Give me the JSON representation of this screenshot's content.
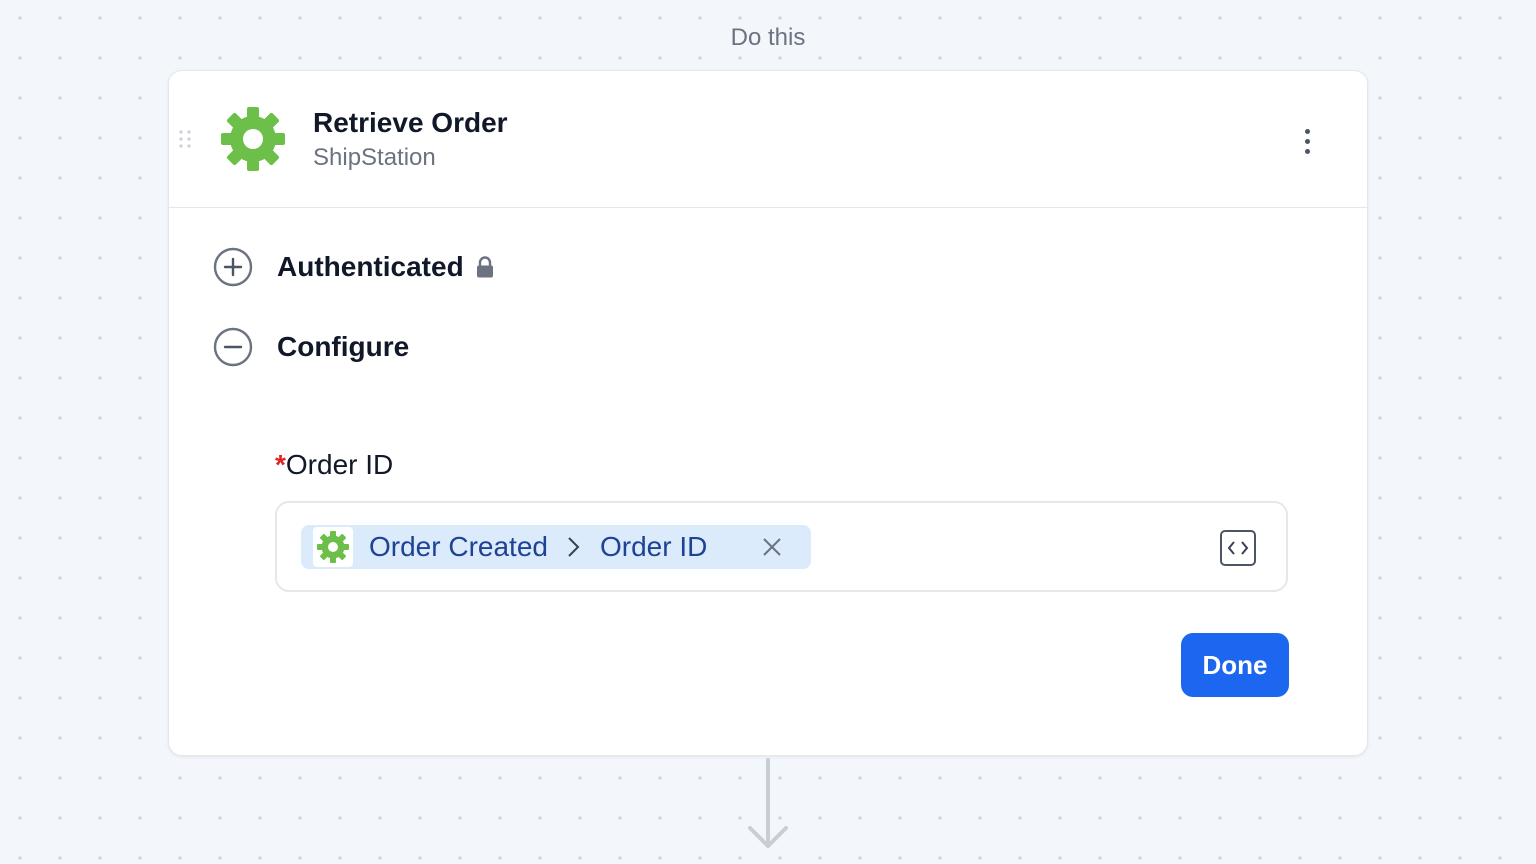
{
  "step_caption": "Do this",
  "step": {
    "title": "Retrieve Order",
    "app_name": "ShipStation",
    "app_icon": "gear-icon",
    "app_icon_color": "#6cc04a"
  },
  "sections": [
    {
      "label": "Authenticated",
      "state": "collapsed",
      "icon": "plus-circle-icon",
      "status_icon": "lock-icon"
    },
    {
      "label": "Configure",
      "state": "expanded",
      "icon": "minus-circle-icon"
    }
  ],
  "field": {
    "required_mark": "*",
    "label": "Order ID",
    "chip": {
      "source": "Order Created",
      "separator_icon": "chevron-right-icon",
      "value": "Order ID",
      "remove_icon": "close-icon"
    },
    "toggle_icon": "code-brackets-icon"
  },
  "actions": {
    "done_label": "Done"
  },
  "colors": {
    "primary": "#1d67f0",
    "chip_bg": "#dcebfb",
    "chip_text": "#1e4294",
    "required": "#dc2626"
  }
}
